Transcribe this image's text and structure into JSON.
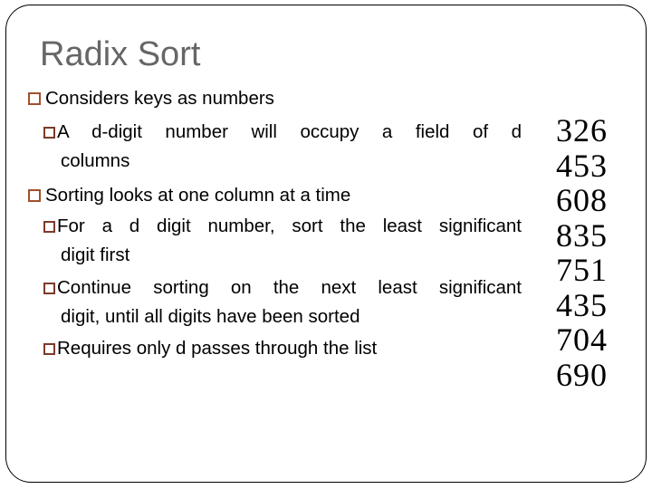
{
  "slide": {
    "title": "Radix Sort",
    "bullets": [
      {
        "icon": "square-bullet-icon",
        "text": "Considers keys as numbers",
        "sub": [
          {
            "icon": "square-bullet-icon",
            "line1": "A  d-digit  number  will  occupy  a  field  of  d",
            "line2": "columns"
          }
        ]
      },
      {
        "icon": "square-bullet-icon",
        "text": "Sorting looks at one column at a time",
        "sub": [
          {
            "icon": "square-bullet-icon",
            "line1": "For a d digit number, sort the least significant",
            "line2": "digit first"
          },
          {
            "icon": "square-bullet-icon",
            "line1": "Continue  sorting  on  the  next  least  significant",
            "line2": "digit, until all digits have been sorted"
          },
          {
            "icon": "square-bullet-icon",
            "line1": "Requires only d passes through the list"
          }
        ]
      }
    ],
    "numbers": [
      "326",
      "453",
      "608",
      "835",
      "751",
      "435",
      "704",
      "690"
    ],
    "colors": {
      "title": "#666666",
      "bullet_box": "#a0522d",
      "sub_bullet_box": "#7b3b2a",
      "text": "#000000",
      "frame": "#000000"
    }
  }
}
